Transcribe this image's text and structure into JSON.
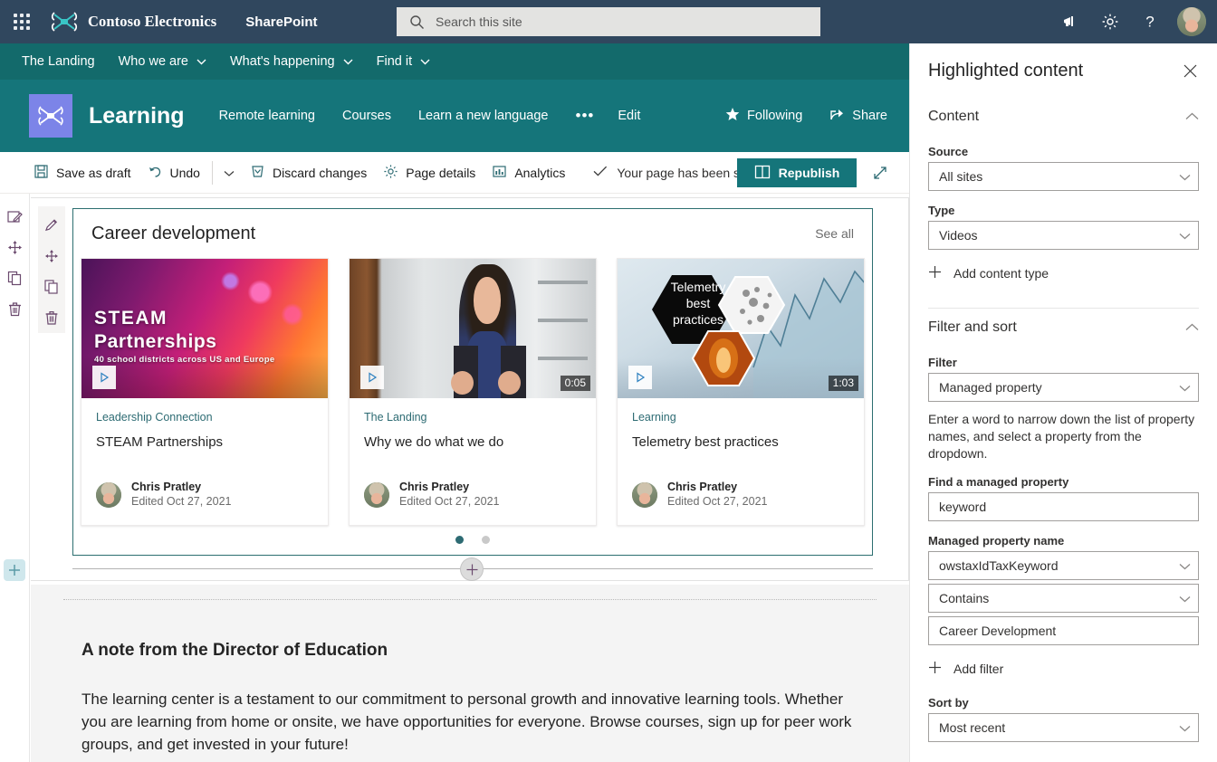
{
  "suite": {
    "waffle_label": "app-launcher",
    "brand": "Contoso Electronics",
    "app_name": "SharePoint",
    "search_placeholder": "Search this site",
    "icons": [
      "megaphone-icon",
      "gear-icon",
      "help-icon",
      "account-avatar"
    ]
  },
  "site_nav": {
    "items": [
      {
        "label": "The Landing",
        "has_chevron": false
      },
      {
        "label": "Who we are",
        "has_chevron": true
      },
      {
        "label": "What's happening",
        "has_chevron": true
      },
      {
        "label": "Find it",
        "has_chevron": true
      }
    ]
  },
  "site_header": {
    "title": "Learning",
    "links": [
      {
        "label": "Remote learning"
      },
      {
        "label": "Courses"
      },
      {
        "label": "Learn a new language"
      },
      {
        "label": "•••"
      },
      {
        "label": "Edit"
      }
    ],
    "following_label": "Following",
    "share_label": "Share"
  },
  "command_bar": {
    "save_as_draft": "Save as draft",
    "undo": "Undo",
    "discard_changes": "Discard changes",
    "page_details": "Page details",
    "analytics": "Analytics",
    "status": "Your page has been saved",
    "republish": "Republish",
    "expand_label": "expand-canvas"
  },
  "page_toolbar": {
    "items": [
      "edit-webpart-icon",
      "move-webpart-icon",
      "duplicate-webpart-icon",
      "delete-webpart-icon"
    ]
  },
  "webpart_toolbar": {
    "items": [
      "edit-webpart-icon",
      "move-webpart-icon",
      "duplicate-webpart-icon",
      "delete-webpart-icon"
    ]
  },
  "webpart": {
    "title": "Career development",
    "see_all": "See all",
    "cards": [
      {
        "site": "Leadership Connection",
        "title": "STEAM Partnerships",
        "author": "Chris Pratley",
        "edited": "Edited Oct 27, 2021",
        "duration": "",
        "thumb": "steam-partnerships-thumbnail",
        "thumb_headline": "STEAM",
        "thumb_headline2": "Partnerships",
        "thumb_sub": "40 school districts across US and Europe"
      },
      {
        "site": "The Landing",
        "title": "Why we do what we do",
        "author": "Chris Pratley",
        "edited": "Edited Oct 27, 2021",
        "duration": "0:05",
        "thumb": "presenter-video-thumbnail",
        "thumb_headline": "",
        "thumb_headline2": "",
        "thumb_sub": ""
      },
      {
        "site": "Learning",
        "title": "Telemetry best practices",
        "author": "Chris Pratley",
        "edited": "Edited Oct 27, 2021",
        "duration": "1:03",
        "thumb": "telemetry-best-practices-thumbnail",
        "thumb_headline": "Telemetry",
        "thumb_headline2": "best",
        "thumb_sub": "practices"
      }
    ],
    "dots": [
      {
        "active": true
      },
      {
        "active": false
      }
    ]
  },
  "lower_section": {
    "heading": "A note from the Director of Education",
    "body": "The learning center is a testament to our commitment to personal growth and innovative learning tools. Whether you are learning from home or onsite, we have opportunities for everyone. Browse courses, sign up for peer work groups, and get invested in your future!"
  },
  "property_pane": {
    "title": "Highlighted content",
    "close_label": "close-pane",
    "content_group": {
      "label": "Content",
      "source_label": "Source",
      "source_value": "All sites",
      "type_label": "Type",
      "type_value": "Videos",
      "add_content_type": "Add content type"
    },
    "filter_group": {
      "label": "Filter and sort",
      "filter_label": "Filter",
      "filter_value": "Managed property",
      "help_text": "Enter a word to narrow down the list of property names, and select a property from the dropdown.",
      "find_label": "Find a managed property",
      "find_value": "keyword",
      "managed_property_label": "Managed property name",
      "managed_property_value": "owstaxIdTaxKeyword",
      "operator_value": "Contains",
      "operand_value": "Career Development",
      "add_filter": "Add filter",
      "sort_by_label": "Sort by",
      "sort_by_value": "Most recent"
    }
  },
  "colors": {
    "suite_bar": "#30475e",
    "site_nav": "#136a6b",
    "site_header": "#15757a",
    "accent": "#2d6b73",
    "republish": "#15757a",
    "site_logo": "#7c84e8",
    "add_section": "#cfe7ec"
  }
}
